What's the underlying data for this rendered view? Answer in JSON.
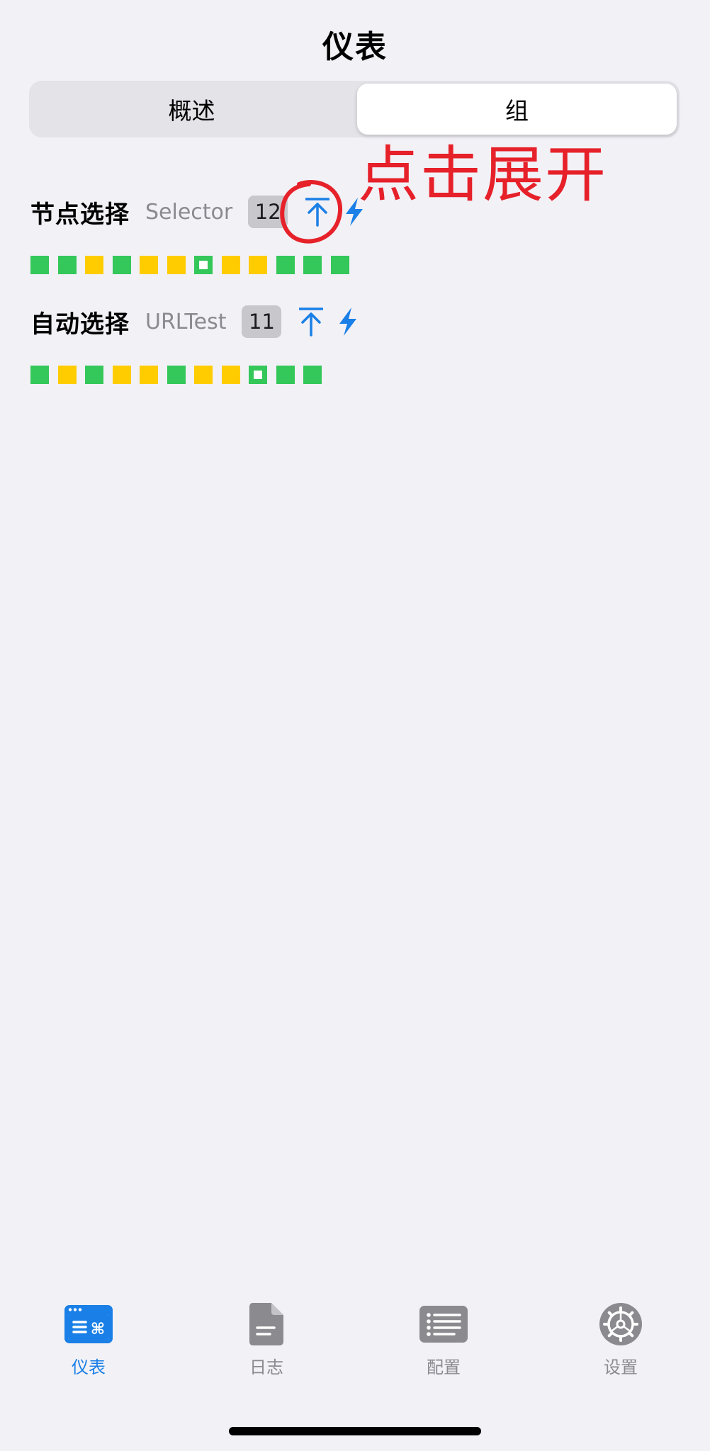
{
  "header": {
    "title": "仪表"
  },
  "segmented_control": {
    "options": [
      "概述",
      "组"
    ],
    "selected": "组"
  },
  "groups": [
    {
      "name": "节点选择",
      "type": "Selector",
      "count": "12",
      "statuses": [
        "green",
        "green",
        "yellow",
        "green",
        "yellow",
        "yellow",
        "selected",
        "yellow",
        "yellow",
        "green",
        "green",
        "green"
      ]
    },
    {
      "name": "自动选择",
      "type": "URLTest",
      "count": "11",
      "statuses": [
        "green",
        "yellow",
        "green",
        "yellow",
        "yellow",
        "green",
        "yellow",
        "yellow",
        "selected",
        "green",
        "green"
      ]
    }
  ],
  "annotation": {
    "text": "点击展开",
    "color": "#e6212a"
  },
  "tab_bar": {
    "tabs": [
      {
        "label": "仪表",
        "icon": "dashboard-icon",
        "active": true
      },
      {
        "label": "日志",
        "icon": "document-icon",
        "active": false
      },
      {
        "label": "配置",
        "icon": "list-icon",
        "active": false
      },
      {
        "label": "设置",
        "icon": "gear-icon",
        "active": false
      }
    ]
  },
  "colors": {
    "accent": "#1a7fe6",
    "status_green": "#34c759",
    "status_yellow": "#ffcc00",
    "background": "#f2f1f6"
  }
}
